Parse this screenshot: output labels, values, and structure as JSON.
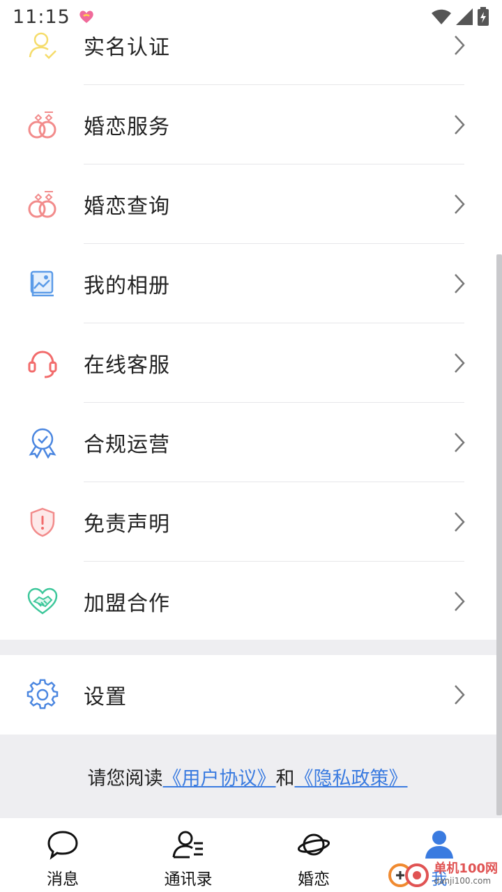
{
  "status_bar": {
    "time": "11:15"
  },
  "menu": [
    {
      "label": "实名认证",
      "icon": "user-verify-icon",
      "color": "#f5dc6a"
    },
    {
      "label": "婚恋服务",
      "icon": "wedding-rings-icon",
      "color": "#f28b8b"
    },
    {
      "label": "婚恋查询",
      "icon": "wedding-rings-icon",
      "color": "#f28b8b"
    },
    {
      "label": "我的相册",
      "icon": "photo-album-icon",
      "color": "#5b9be8"
    },
    {
      "label": "在线客服",
      "icon": "headset-icon",
      "color": "#f26b6b"
    },
    {
      "label": "合规运营",
      "icon": "award-badge-icon",
      "color": "#4a86e0"
    },
    {
      "label": "免责声明",
      "icon": "shield-alert-icon",
      "color": "#f28b8b"
    },
    {
      "label": "加盟合作",
      "icon": "handshake-heart-icon",
      "color": "#3cc79a"
    }
  ],
  "settings": {
    "label": "设置",
    "icon": "gear-icon",
    "color": "#4a86e0"
  },
  "footer": {
    "prefix": "请您阅读",
    "user_agreement": "《用户协议》",
    "and": "和",
    "privacy_policy": "《隐私政策》"
  },
  "tabs": [
    {
      "label": "消息",
      "icon": "chat-bubble-icon"
    },
    {
      "label": "通讯录",
      "icon": "contacts-icon"
    },
    {
      "label": "婚恋",
      "icon": "planet-icon"
    },
    {
      "label": "我",
      "icon": "person-icon",
      "active": true
    }
  ],
  "watermark": {
    "title": "单机100网",
    "url": "danji100.com"
  },
  "colors": {
    "accent": "#3a7be0",
    "section_bg": "#eeeef1",
    "divider": "#e6e6e9"
  }
}
